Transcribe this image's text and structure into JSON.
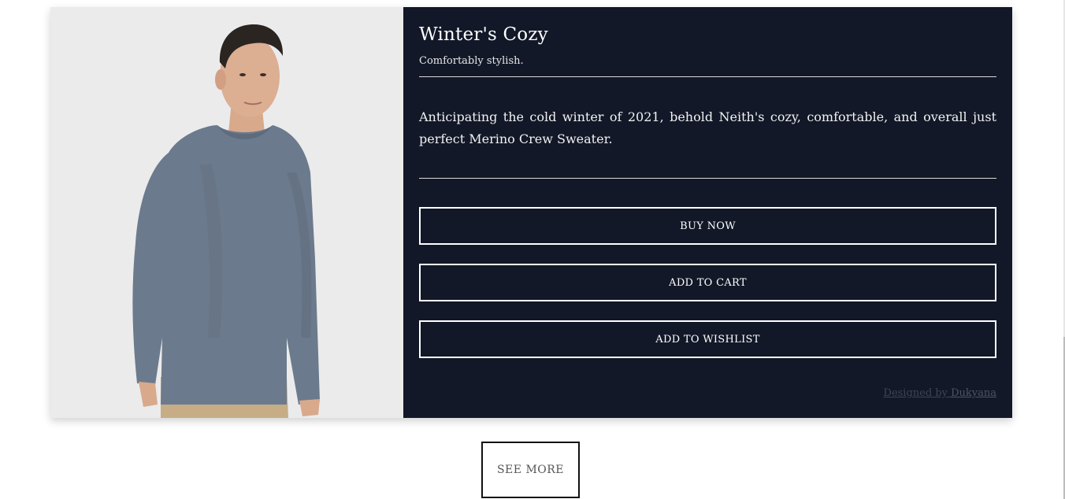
{
  "product": {
    "title": "Winter's Cozy",
    "subtitle": "Comfortably stylish.",
    "description": "Anticipating the cold winter of 2021, behold Neith's cozy, comfortable, and overall just perfect Merino Crew Sweater.",
    "image_alt": "Man wearing grey merino crew sweater"
  },
  "actions": {
    "buy_now": "BUY NOW",
    "add_to_cart": "ADD TO CART",
    "add_to_wishlist": "ADD TO WISHLIST"
  },
  "credit": {
    "prefix": "Designed by ",
    "author": "Dukyana"
  },
  "see_more": "SEE MORE",
  "colors": {
    "panel_bg": "#121828",
    "image_bg": "#ebebeb",
    "sweater": "#6c7a8d",
    "button_border": "#ffffff"
  }
}
